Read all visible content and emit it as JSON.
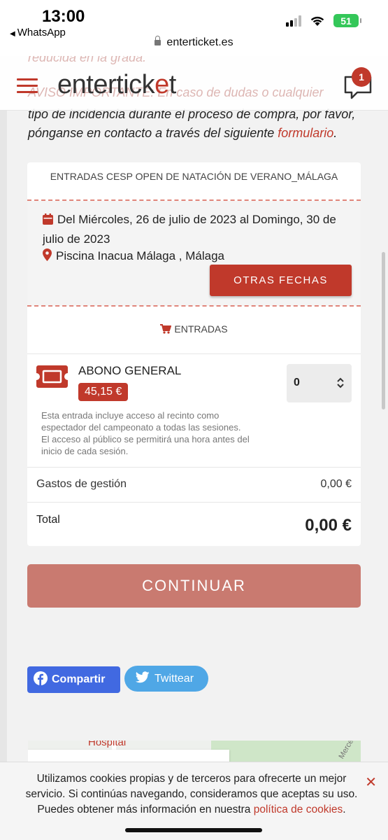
{
  "status_bar": {
    "time": "13:00",
    "back_app": "WhatsApp",
    "battery": "51",
    "url": "enterticket.es"
  },
  "header": {
    "logo_pre": "enterti",
    "logo_mid": "ck",
    "logo_accent": "e",
    "logo_post": "t",
    "chat_badge": "1",
    "background_text_1": "reducida en la grada.",
    "background_text_2": "AVISO IMPORTANTE: En caso de dudas o cualquier"
  },
  "notice": {
    "line": "tipo de incidencia durante el proceso de compra, por favor, pónganse en contacto a través del siguiente",
    "link": "formulario",
    "end": "."
  },
  "event": {
    "title": "ENTRADAS CESP OPEN DE NATACIÓN DE VERANO_MÁLAGA",
    "dates": "Del Miércoles, 26 de julio de 2023 al Domingo, 30 de julio de 2023",
    "venue": "Piscina Inacua Málaga , Málaga",
    "other_dates_button": "OTRAS FECHAS"
  },
  "tickets": {
    "heading": "ENTRADAS",
    "items": [
      {
        "name": "ABONO GENERAL",
        "price": "45,15 €",
        "quantity": "0",
        "description": "Esta entrada incluye acceso al recinto como espectador del campeonato a todas las sesiones. El acceso al público se permitirá una hora antes del inicio de cada sesión."
      }
    ],
    "fees_label": "Gastos de gestión",
    "fees_value": "0,00 €",
    "total_label": "Total",
    "total_value": "0,00 €"
  },
  "continue_button": "CONTINUAR",
  "share": {
    "facebook": "Compartir",
    "twitter": "Twittear"
  },
  "map": {
    "label": "Hospital",
    "label2": "Merce"
  },
  "cookie": {
    "text": "Utilizamos cookies propias y de terceros para ofrecerte un mejor servicio. Si continúas navegando, consideramos que aceptas su uso. Puedes obtener más información en nuestra",
    "link": "política de cookies",
    "end": ".",
    "close": "✕"
  },
  "colors": {
    "brand": "#c0392b",
    "continue_disabled": "#c97a70",
    "facebook": "#4169e1",
    "twitter": "#4fa7e6"
  },
  "icons": [
    "menu-icon",
    "chat-icon",
    "calendar-icon",
    "location-pin-icon",
    "cart-icon",
    "ticket-icon",
    "stepper-arrows-icon",
    "facebook-icon",
    "twitter-icon",
    "close-icon",
    "lock-icon"
  ]
}
